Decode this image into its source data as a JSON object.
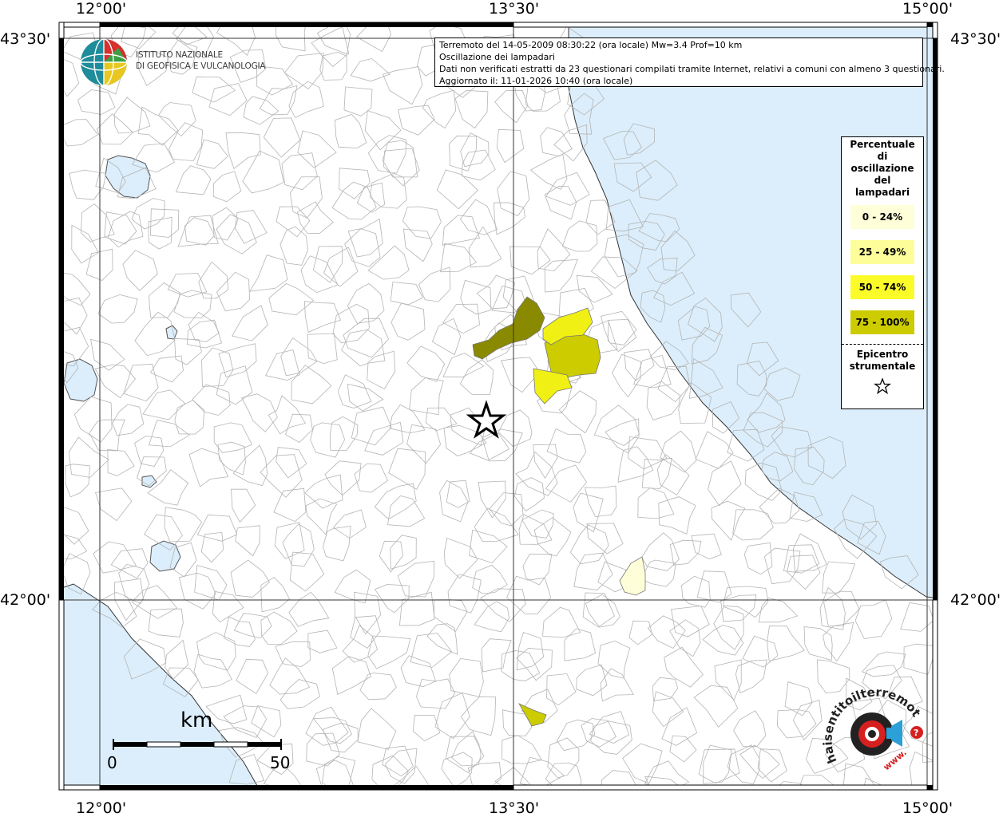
{
  "axis_labels": {
    "lon_top": [
      "12°00'",
      "13°30'",
      "15°00'"
    ],
    "lon_bottom": [
      "12°00'",
      "13°30'",
      "15°00'"
    ],
    "lat_left": [
      "43°30'",
      "42°00'"
    ],
    "lat_right": [
      "43°30'",
      "42°00'"
    ]
  },
  "info": {
    "line1": "Terremoto del 14-05-2009 08:30:22 (ora locale) Mw=3.4 Prof=10 km",
    "line2": "Oscillazione dei lampadari",
    "line3": "Dati non verificati estratti da 23 questionari compilati tramite Internet, relativi a comuni con almeno 3 questionari.",
    "line4": "Aggiornato il: 11-01-2026 10:40 (ora locale)"
  },
  "logo": {
    "line1": "ISTITUTO NAZIONALE",
    "line2": "DI GEOFISICA E VULCANOLOGIA"
  },
  "legend": {
    "title_lines": [
      "Percentuale",
      "di",
      "oscillazione",
      "del",
      "lampadari"
    ],
    "items": [
      {
        "label": "0 - 24%",
        "color": "#fefed8"
      },
      {
        "label": "25 - 49%",
        "color": "#fdfd9a"
      },
      {
        "label": "50 - 74%",
        "color": "#fbfb2a"
      },
      {
        "label": "75 - 100%",
        "color": "#cccc00"
      }
    ],
    "epicentre_lines": [
      "Epicentro",
      "strumentale"
    ]
  },
  "scale": {
    "unit": "km",
    "start": "0",
    "end": "50"
  },
  "badge": {
    "text": "haisentitoilterremoto.it",
    "www": "www."
  },
  "colors": {
    "sea": "#dceefb",
    "land": "#ffffff",
    "border": "#aaaaaa",
    "class_75_100_dark": "#8a8a00",
    "class_75_100": "#cccc00",
    "class_50_74": "#f0f014",
    "class_0_24": "#fefed8"
  }
}
